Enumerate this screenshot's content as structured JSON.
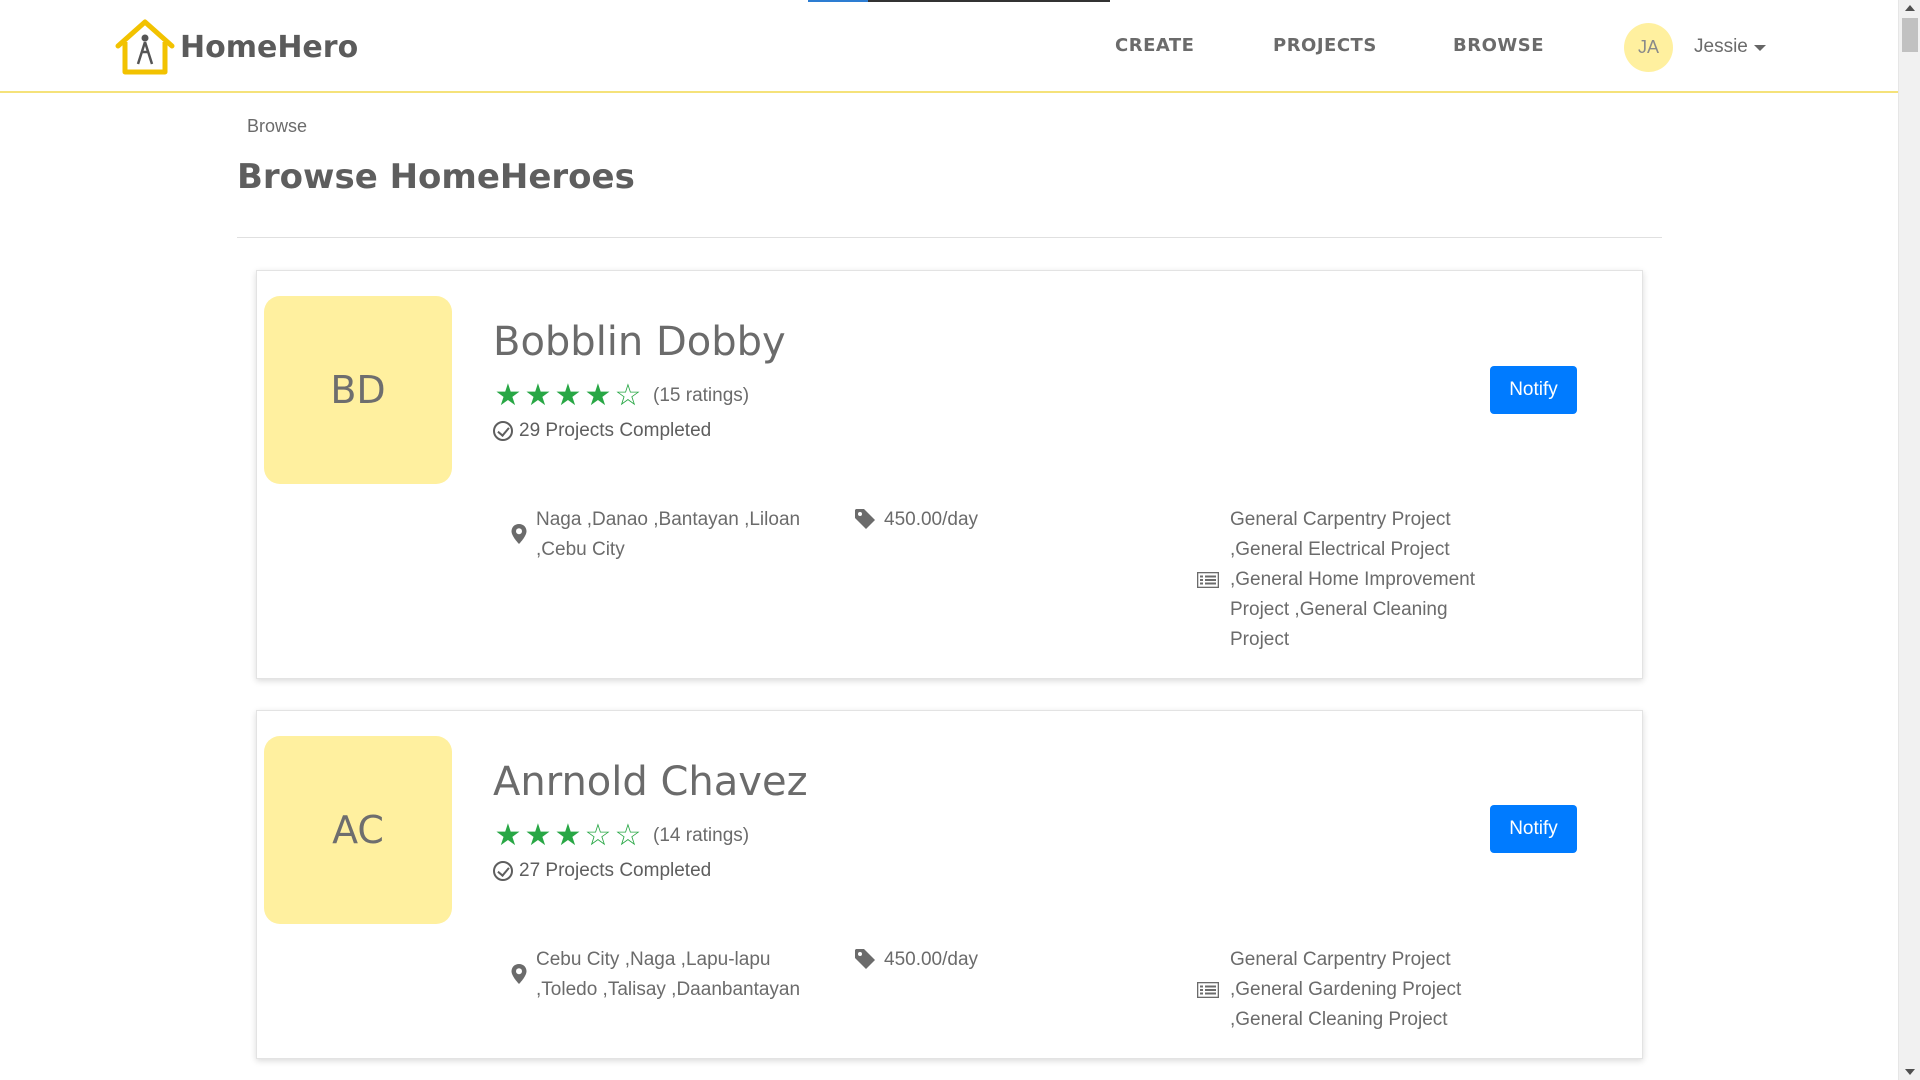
{
  "app": {
    "brand_name": "HomeHero"
  },
  "nav": {
    "items": [
      {
        "label": "CREATE"
      },
      {
        "label": "PROJECTS"
      },
      {
        "label": "BROWSE"
      }
    ],
    "user": {
      "initials": "JA",
      "name": "Jessie"
    }
  },
  "page": {
    "breadcrumb": "Browse",
    "title": "Browse HomeHeroes"
  },
  "heroes": [
    {
      "initials": "BD",
      "name": "Bobblin Dobby",
      "rating": 4,
      "max_rating": 5,
      "ratings_label": "(15 ratings)",
      "projects_completed": "29 Projects Completed",
      "locations": "Naga ,Danao ,Bantayan ,Liloan ,Cebu City",
      "price": "450.00/day",
      "services": "General Carpentry Project ,General Electrical Project ,General Home Improvement Project ,General Cleaning Project",
      "notify_label": "Notify"
    },
    {
      "initials": "AC",
      "name": "Anrnold Chavez",
      "rating": 3,
      "max_rating": 5,
      "ratings_label": "(14 ratings)",
      "projects_completed": "27 Projects Completed",
      "locations": "Cebu City ,Naga ,Lapu-lapu ,Toledo ,Talisay ,Daanbantayan",
      "price": "450.00/day",
      "services": "General Carpentry Project ,General Gardening Project ,General Cleaning Project",
      "notify_label": "Notify"
    }
  ],
  "colors": {
    "accent_yellow": "#fff09f",
    "header_border": "#f5e27a",
    "star_green": "#28a745",
    "button_blue": "#007bff"
  },
  "icons": {
    "logo": "house-logo-icon",
    "location": "map-pin-icon",
    "price": "tag-icon",
    "services": "list-icon",
    "completed": "check-circle-icon"
  }
}
